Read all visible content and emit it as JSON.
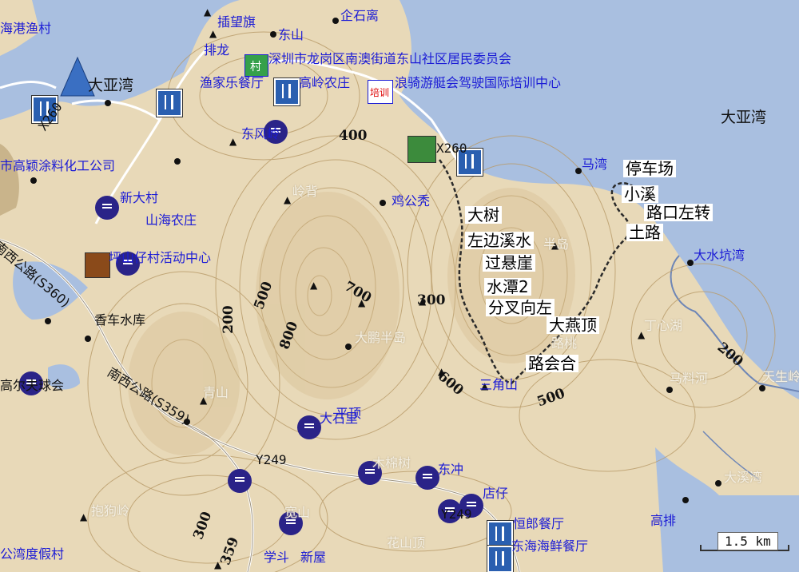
{
  "map": {
    "scale_label": "1.5 km",
    "colors": {
      "sea": "#a9bfe0",
      "land": "#e8d9b8",
      "route": "#2a2a2a",
      "label_blue": "#1b1bd6",
      "poi": "#2a2388"
    },
    "places": {
      "haigang": "海港渔村",
      "qishilu": "企石离",
      "dongshan": "东山",
      "chawangqi": "插望旗",
      "paelong": "排龙",
      "juweihui": "深圳市龙岗区南澳街道东山社区居民委员会",
      "dayawan_n": "大亚湾",
      "nongzhuang_n": "高岭农庄",
      "peixun_center": "浪骑游艇会驾驶国际培训中心",
      "yujia": "渔家乐餐厅",
      "dongfengling": "东风岭",
      "x260_a": "X260",
      "x260_b": "X260",
      "dayawan_e": "大亚湾",
      "chemical": "市高颖涂料化工公司",
      "xindacun": "新大村",
      "shanhai": "山海农庄",
      "jigongxiu": "鸡公秃",
      "mawan": "马湾",
      "lingbei": "岭背",
      "activity": "坪山仔村活动中心",
      "s360": "南西公路(S360)",
      "dashuikeng": "大水坑湾",
      "xiangche": "香车水库",
      "dapeng": "大鹏半岛",
      "dingxinhu": "丁心湖",
      "golf": "高尔夫球会",
      "s359": "南西公路(S359)",
      "qingshan": "青山",
      "pingding": "平顶",
      "dashili": "大石里",
      "majiahe": "马料河",
      "y249_a": "Y249",
      "mumianshu": "木棉树",
      "dongchong": "东冲",
      "y249_b": "Y249",
      "dianzai": "店仔",
      "baoling": "抱狗岭",
      "huanlang": "恒郎餐厅",
      "gaopai": "高排",
      "dongshaihai": "东海海鲜餐厅",
      "dasheng": "大溪湾",
      "xuedou": "学斗",
      "xinwu": "新屋",
      "huashan": "花山顶",
      "resort": "公湾度假村",
      "sanjiao": "三角山",
      "banjiao": "半岛",
      "lutao": "路桃",
      "kuancun": "宽山",
      "tiansheng": "天生岭"
    },
    "annotations": {
      "parking": "停车场",
      "xiaoxi": "小溪",
      "turn_left": "路口左转",
      "tulu": "土路",
      "dashu": "大树",
      "zuobian": "左边溪水",
      "guoxuanya": "过悬崖",
      "shuitan": "水潭2",
      "fencha": "分叉向左",
      "dayanding": "大燕顶",
      "luhuihe": "路会合"
    },
    "contours": [
      "400",
      "500",
      "700",
      "300",
      "800",
      "200",
      "600",
      "500",
      "200",
      "300",
      "359"
    ],
    "badges": {
      "peixun": "培训",
      "cun": "村"
    }
  }
}
